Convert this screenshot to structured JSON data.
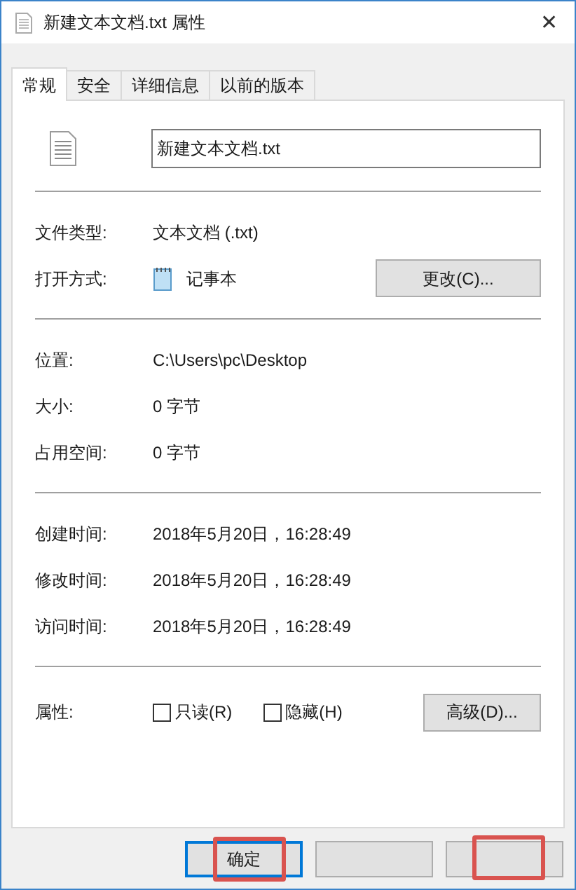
{
  "window": {
    "title": "新建文本文档.txt 属性",
    "close": "✕"
  },
  "tabs": [
    {
      "label": "常规",
      "selected": true
    },
    {
      "label": "安全",
      "selected": false
    },
    {
      "label": "详细信息",
      "selected": false
    },
    {
      "label": "以前的版本",
      "selected": false
    }
  ],
  "file_name": "新建文本文档.txt",
  "sections": [
    [
      {
        "kind": "text",
        "label": "文件类型:",
        "value": "文本文档 (.txt)"
      },
      {
        "kind": "app",
        "label": "打开方式:",
        "value": "记事本",
        "button": "更改(C)..."
      }
    ],
    [
      {
        "kind": "text",
        "label": "位置:",
        "value": "C:\\Users\\pc\\Desktop"
      },
      {
        "kind": "text",
        "label": "大小:",
        "value": "0 字节"
      },
      {
        "kind": "text",
        "label": "占用空间:",
        "value": "0 字节"
      }
    ],
    [
      {
        "kind": "text",
        "label": "创建时间:",
        "value": "2018年5月20日，16:28:49"
      },
      {
        "kind": "text",
        "label": "修改时间:",
        "value": "2018年5月20日，16:28:49"
      },
      {
        "kind": "text",
        "label": "访问时间:",
        "value": "2018年5月20日，16:28:49"
      }
    ],
    [
      {
        "kind": "attributes",
        "label": "属性:",
        "checkboxes": [
          {
            "label": "只读(R)",
            "checked": false
          },
          {
            "label": "隐藏(H)",
            "checked": false
          }
        ],
        "button": "高级(D)..."
      }
    ]
  ],
  "buttons": [
    {
      "label": "确定",
      "default": true,
      "highlighted": true
    },
    {
      "default": false,
      "highlighted": false
    },
    {
      "default": false,
      "highlighted": true
    }
  ]
}
